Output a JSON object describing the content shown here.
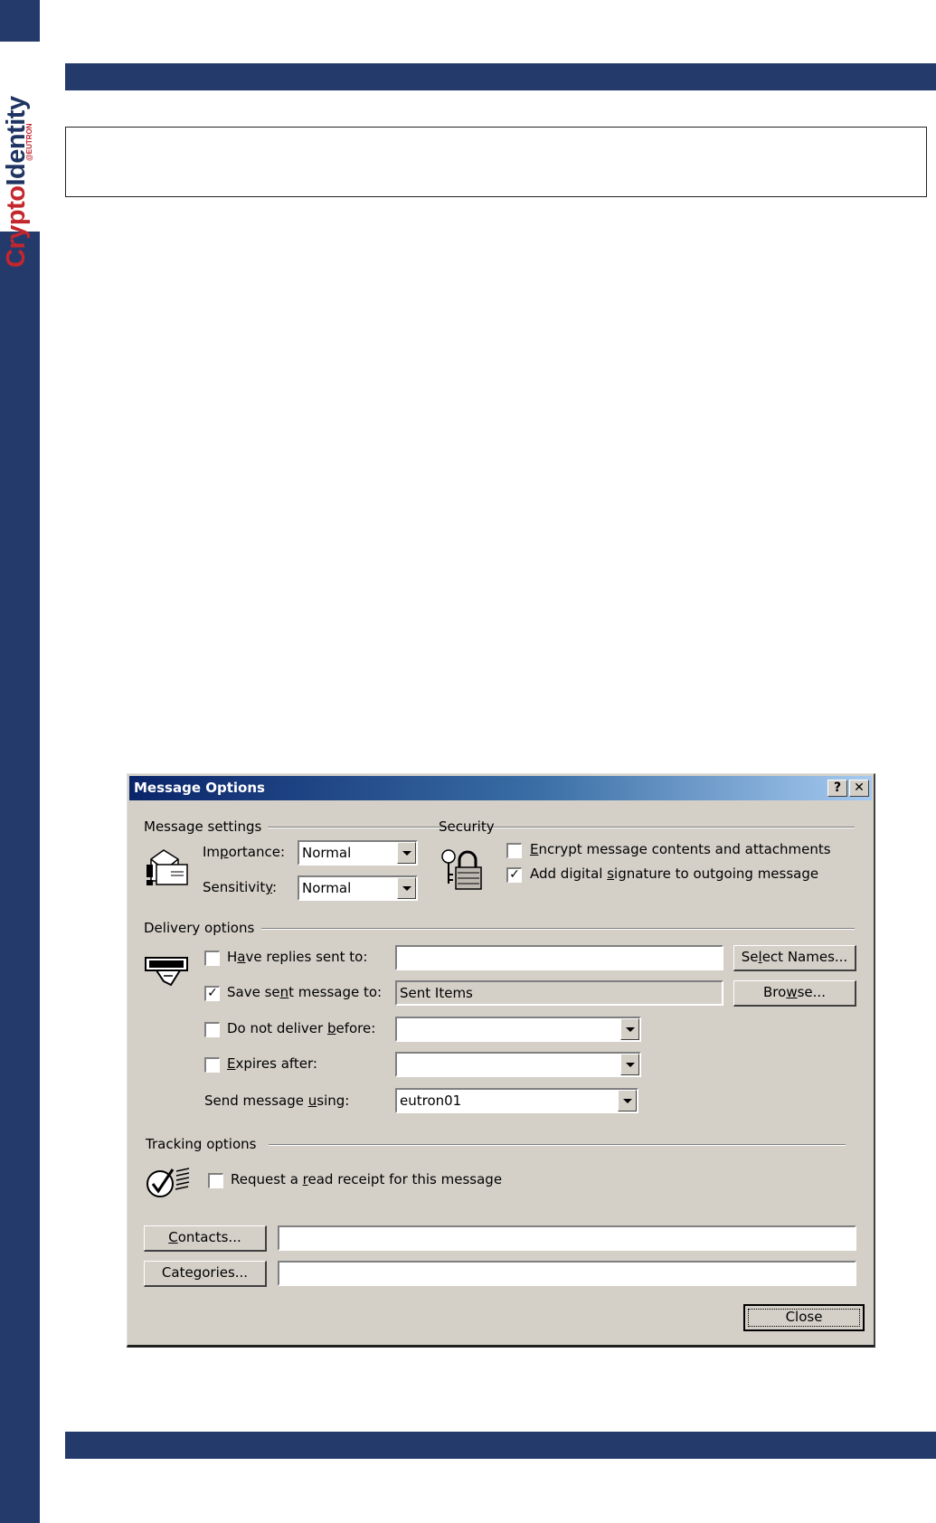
{
  "brand": {
    "name_part1": "Crypto",
    "name_part2": "Identity",
    "tagline": "@EUTRON"
  },
  "dialog": {
    "title": "Message Options",
    "help_button": "?",
    "close_x": "✕",
    "message_settings": {
      "heading": "Message settings",
      "importance_label_pre": "Im",
      "importance_label_u": "p",
      "importance_label_post": "ortance:",
      "importance_value": "Normal",
      "sensitivity_label_pre": "Sensitivit",
      "sensitivity_label_u": "y",
      "sensitivity_label_post": ":",
      "sensitivity_value": "Normal"
    },
    "security": {
      "heading": "Security",
      "encrypt_u": "E",
      "encrypt_post": "ncrypt message contents and attachments",
      "encrypt_checked": false,
      "sign_pre": "Add digital ",
      "sign_u": "s",
      "sign_post": "ignature to outgoing message",
      "sign_checked": true,
      "sign_mark": "✓"
    },
    "delivery": {
      "heading": "Delivery options",
      "replies_pre": "H",
      "replies_u": "a",
      "replies_post": "ve replies sent to:",
      "replies_value": "",
      "replies_checked": false,
      "select_names_pre": "Se",
      "select_names_u": "l",
      "select_names_post": "ect Names...",
      "save_pre": "Save se",
      "save_u": "n",
      "save_post": "t message to:",
      "save_value": "Sent Items",
      "save_checked": true,
      "save_mark": "✓",
      "browse_pre": "Bro",
      "browse_u": "w",
      "browse_post": "se...",
      "deliver_pre": "Do not deliver ",
      "deliver_u": "b",
      "deliver_post": "efore:",
      "deliver_value": "",
      "expires_u": "E",
      "expires_post": "xpires after:",
      "expires_value": "",
      "send_using_pre": "Send message ",
      "send_using_u": "u",
      "send_using_post": "sing:",
      "send_using_value": "eutron01"
    },
    "tracking": {
      "heading": "Tracking options",
      "receipt_pre": "Request a ",
      "receipt_u": "r",
      "receipt_post": "ead receipt for this message",
      "receipt_checked": false
    },
    "contacts_u": "C",
    "contacts_post": "ontacts...",
    "contacts_value": "",
    "categories_pre": "Cate",
    "categories_u": "g",
    "categories_post": "ories...",
    "categories_value": "",
    "close_button": "Close"
  }
}
